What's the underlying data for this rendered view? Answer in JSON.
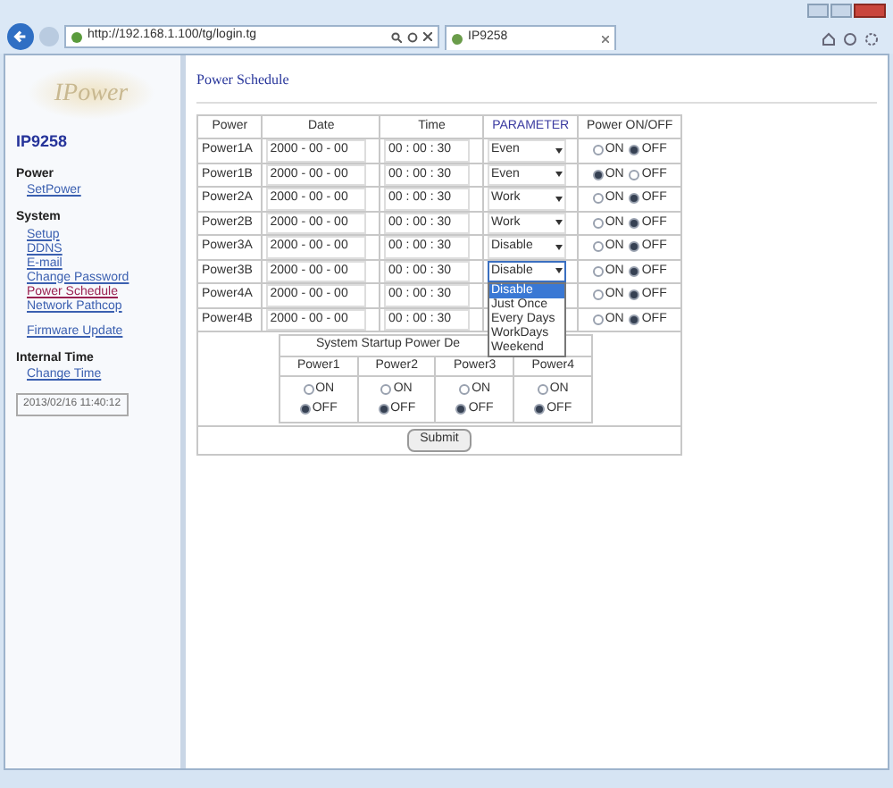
{
  "browser": {
    "address": "http://192.168.1.100/tg/login.tg",
    "tab_title": "IP9258"
  },
  "sidebar": {
    "logo": "IPower",
    "model": "IP9258",
    "sections": [
      {
        "heading": "Power",
        "links": [
          {
            "label": "SetPower",
            "selected": false
          }
        ]
      },
      {
        "heading": "System",
        "links": [
          {
            "label": "Setup",
            "selected": false
          },
          {
            "label": "DDNS",
            "selected": false
          },
          {
            "label": "E-mail",
            "selected": false
          },
          {
            "label": "Change Password",
            "selected": false
          },
          {
            "label": "Power Schedule",
            "selected": true
          },
          {
            "label": "Network Pathcop",
            "selected": false
          }
        ]
      },
      {
        "links": [
          {
            "label": "Firmware Update",
            "selected": false
          }
        ]
      },
      {
        "heading": "Internal Time",
        "links": [
          {
            "label": "Change Time",
            "selected": false
          }
        ]
      }
    ],
    "clock": "2013/02/16 11:40:12"
  },
  "page": {
    "title": "Power Schedule",
    "columns": [
      "Power",
      "Date",
      "Time",
      "PARAMETER",
      "Power ON/OFF"
    ],
    "rows": [
      {
        "name": "Power1A",
        "date": "2000 - 00 - 00",
        "time": "00 : 00 : 30",
        "parameter": "Even",
        "on": false,
        "on_label": "ON",
        "off_label": "OFF"
      },
      {
        "name": "Power1B",
        "date": "2000 - 00 - 00",
        "time": "00 : 00 : 30",
        "parameter": "Even",
        "on": true,
        "on_label": "ON",
        "off_label": "OFF"
      },
      {
        "name": "Power2A",
        "date": "2000 - 00 - 00",
        "time": "00 : 00 : 30",
        "parameter": "Work",
        "on": false,
        "on_label": "ON",
        "off_label": "OFF"
      },
      {
        "name": "Power2B",
        "date": "2000 - 00 - 00",
        "time": "00 : 00 : 30",
        "parameter": "Work",
        "on": false,
        "on_label": "ON",
        "off_label": "OFF"
      },
      {
        "name": "Power3A",
        "date": "2000 - 00 - 00",
        "time": "00 : 00 : 30",
        "parameter": "Disable",
        "on": false,
        "on_label": "ON",
        "off_label": "OFF"
      },
      {
        "name": "Power3B",
        "date": "2000 - 00 - 00",
        "time": "00 : 00 : 30",
        "parameter": "Disable",
        "on": false,
        "on_label": "ON",
        "off_label": "OFF",
        "expanded": true,
        "options": [
          {
            "label": "Disable",
            "selected": true
          },
          {
            "label": "Just Once",
            "selected": false
          },
          {
            "label": "Every Days",
            "selected": false
          },
          {
            "label": "WorkDays",
            "selected": false
          },
          {
            "label": "Weekend",
            "selected": false
          }
        ]
      },
      {
        "name": "Power4A",
        "date": "2000 - 00 - 00",
        "time": "00 : 00 : 30",
        "on": false,
        "on_label": "ON",
        "off_label": "OFF"
      },
      {
        "name": "Power4B",
        "date": "2000 - 00 - 00",
        "time": "00 : 00 : 30",
        "on": false,
        "on_label": "ON",
        "off_label": "OFF"
      }
    ],
    "startup": {
      "title": "System Startup Power De",
      "outlets": [
        {
          "name": "Power1",
          "on": false,
          "on_label": "ON",
          "off_label": "OFF"
        },
        {
          "name": "Power2",
          "on": false,
          "on_label": "ON",
          "off_label": "OFF"
        },
        {
          "name": "Power3",
          "on": false,
          "on_label": "ON",
          "off_label": "OFF"
        },
        {
          "name": "Power4",
          "on": false,
          "on_label": "ON",
          "off_label": "OFF"
        }
      ]
    },
    "submit": "Submit"
  }
}
